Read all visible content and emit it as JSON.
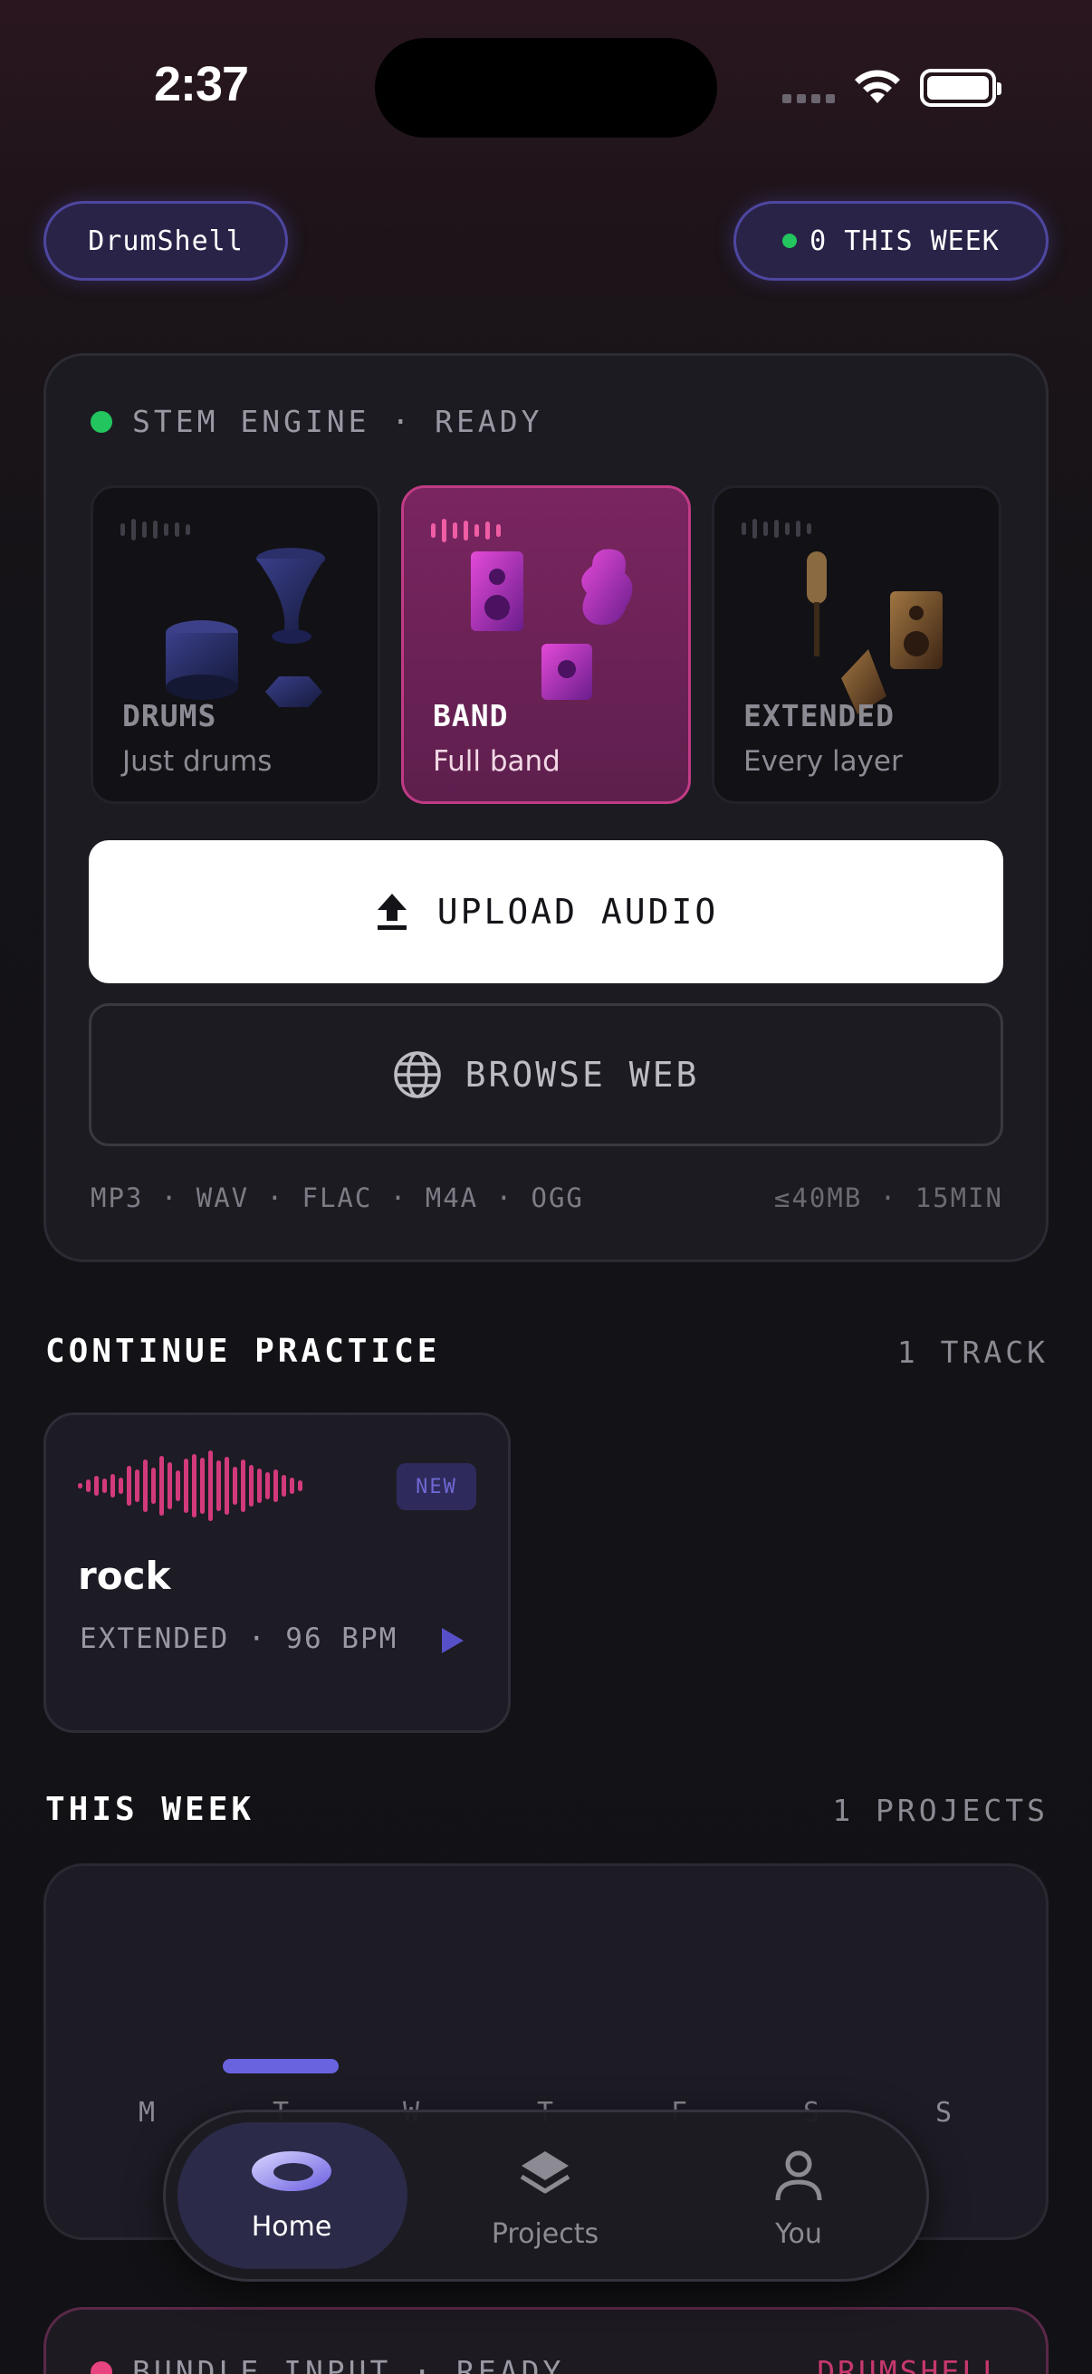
{
  "status_bar": {
    "time": "2:37"
  },
  "header": {
    "brand": "DrumShell",
    "weekly_count": "0 THIS WEEK"
  },
  "stem_engine": {
    "status": "STEM ENGINE · READY",
    "modes": [
      {
        "name": "DRUMS",
        "desc": "Just drums",
        "selected": false
      },
      {
        "name": "BAND",
        "desc": "Full band",
        "selected": true
      },
      {
        "name": "EXTENDED",
        "desc": "Every layer",
        "selected": false
      }
    ],
    "upload_label": "UPLOAD AUDIO",
    "browse_label": "BROWSE WEB",
    "formats": "MP3 · WAV · FLAC · M4A · OGG",
    "limits": "≤40MB · 15MIN"
  },
  "continue_practice": {
    "title": "CONTINUE PRACTICE",
    "count": "1 TRACK",
    "track": {
      "badge": "NEW",
      "name": "rock",
      "meta": "EXTENDED · 96 BPM"
    }
  },
  "this_week": {
    "title": "THIS WEEK",
    "count": "1 PROJECTS",
    "days": [
      "M",
      "T",
      "W",
      "T",
      "F",
      "S",
      "S"
    ]
  },
  "bundle": {
    "status": "BUNDLE INPUT · READY",
    "brand": "DRUMSHELL"
  },
  "tabs": [
    {
      "label": "Home",
      "icon": "home-ring-icon",
      "active": true
    },
    {
      "label": "Projects",
      "icon": "layers-icon",
      "active": false
    },
    {
      "label": "You",
      "icon": "person-icon",
      "active": false
    }
  ],
  "colors": {
    "accent_pink": "#c03b85",
    "accent_indigo": "#6a63e0",
    "ready_green": "#22c55e"
  }
}
